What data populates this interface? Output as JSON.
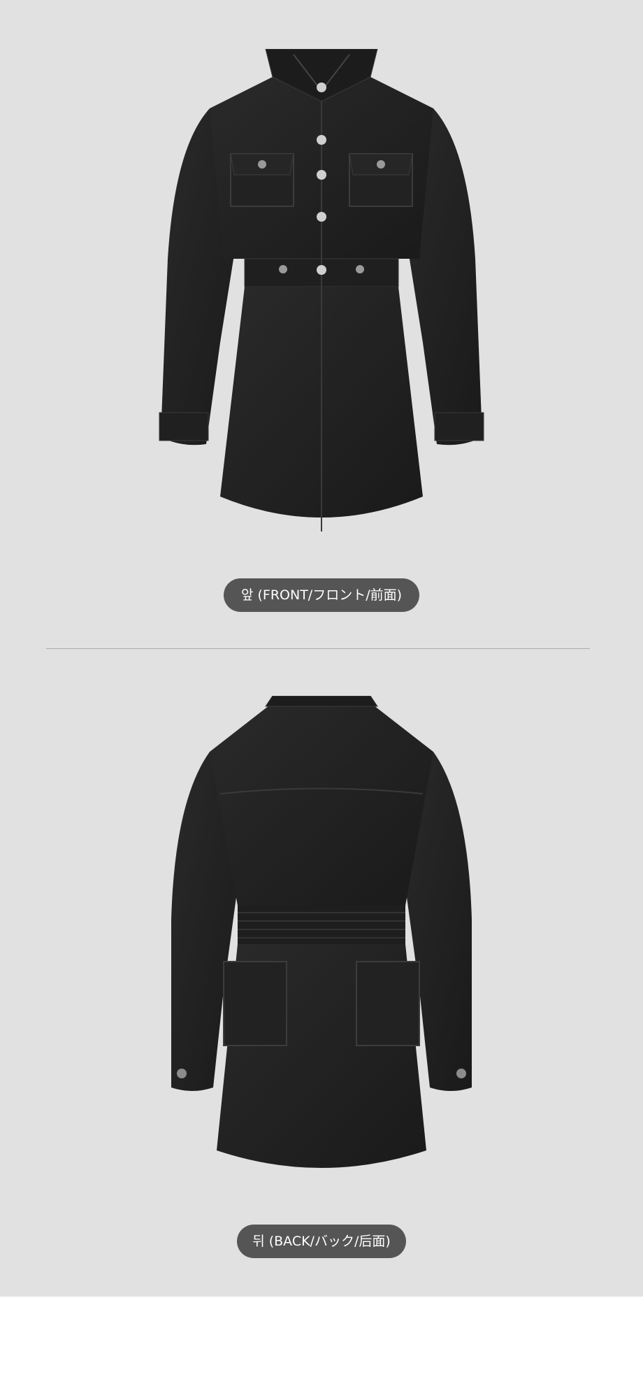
{
  "front": {
    "label": "앞 (FRONT/フロント/前面)"
  },
  "back": {
    "label": "뒤 (BACK/バック/后面)"
  },
  "colors": {
    "background": "#e1e1e1",
    "garment": "#232323",
    "pill": "#555555",
    "pill_text": "#ffffff",
    "divider": "#aaaaaa"
  }
}
